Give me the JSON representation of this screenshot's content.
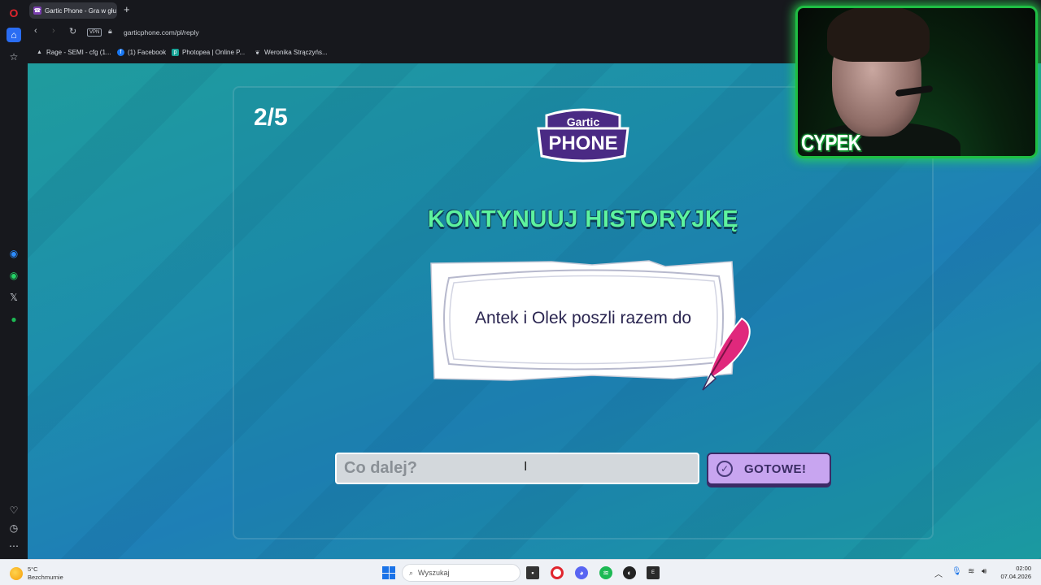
{
  "browser": {
    "tab_title": "Gartic Phone - Gra w głu...",
    "tab_icon": "gartic-favicon",
    "new_tab": "+",
    "vpn_label": "VPN",
    "url": "garticphone.com/pl/reply",
    "bookmarks": [
      {
        "label": "Rage - SEMI - cfg (1...",
        "icon": "rage-icon",
        "color": "#6b7280"
      },
      {
        "label": "(1) Facebook",
        "icon": "facebook-icon",
        "color": "#1877f2"
      },
      {
        "label": "Photopea | Online P...",
        "icon": "photopea-icon",
        "color": "#18a497"
      },
      {
        "label": "Weronika Strączyńs...",
        "icon": "leaf-icon",
        "color": "#6b7280"
      }
    ]
  },
  "game": {
    "round_counter": "2/5",
    "logo_top": "Gartic",
    "logo_bottom": "PHONE",
    "heading": "KONTYNUUJ HISTORYJKĘ",
    "story_text": "Antek i Olek poszli razem do",
    "input_placeholder": "Co dalej?",
    "done_label": "GOTOWE!",
    "colors": {
      "heading": "#5ef39e",
      "button": "#c8a5f0",
      "quill": "#e0287c"
    }
  },
  "webcam": {
    "name": "CYPEK"
  },
  "taskbar": {
    "weather_temp": "5°C",
    "weather_desc": "Bezchmurnie",
    "search_placeholder": "Wyszukaj",
    "time": "02:00",
    "date": "07.04.2026"
  }
}
